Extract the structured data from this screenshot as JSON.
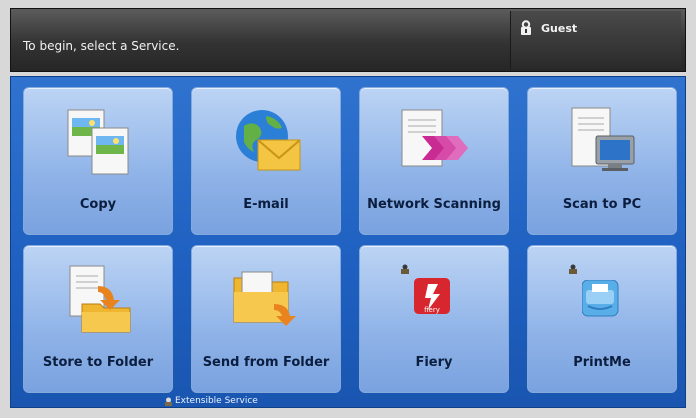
{
  "header": {
    "message": "To begin, select a Service.",
    "user_name": "Guest"
  },
  "services": [
    {
      "label": "Copy",
      "icon": "copy-icon"
    },
    {
      "label": "E-mail",
      "icon": "email-icon"
    },
    {
      "label": "Network Scanning",
      "icon": "network-scanning-icon"
    },
    {
      "label": "Scan to PC",
      "icon": "scan-to-pc-icon"
    },
    {
      "label": "Store to Folder",
      "icon": "store-to-folder-icon"
    },
    {
      "label": "Send from Folder",
      "icon": "send-from-folder-icon"
    },
    {
      "label": "Fiery",
      "icon": "fiery-icon",
      "locked": true
    },
    {
      "label": "PrintMe",
      "icon": "printme-icon",
      "locked": true
    }
  ],
  "footer": {
    "label": "Extensible Service"
  },
  "colors": {
    "panel": "#2f73cf",
    "tile": "#bcd4f4",
    "topbar": "#333333"
  }
}
